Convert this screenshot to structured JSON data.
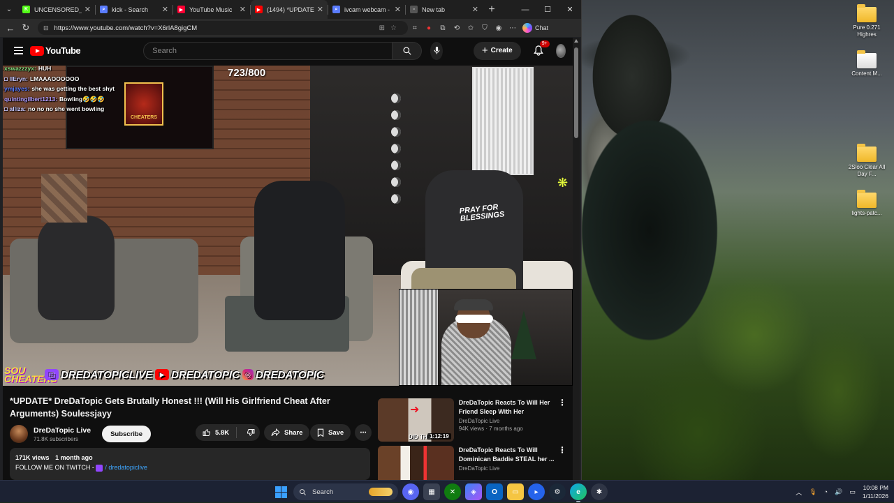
{
  "browser": {
    "tabs": [
      {
        "label": "UNCENSORED_TV S",
        "favicon": "kick-icon",
        "color": "#53fc18",
        "glyph": "K"
      },
      {
        "label": "kick - Search",
        "favicon": "search-icon",
        "color": "#5a7cff",
        "glyph": "⌕"
      },
      {
        "label": "YouTube Music",
        "favicon": "youtube-music-icon",
        "color": "#ff0033",
        "glyph": "▶"
      },
      {
        "label": "(1494) *UPDATE",
        "favicon": "youtube-icon",
        "color": "#ff0000",
        "glyph": "▶",
        "active": true
      },
      {
        "label": "ivcam webcam - Sea",
        "favicon": "search-icon",
        "color": "#5a7cff",
        "glyph": "⌕"
      },
      {
        "label": "New tab",
        "favicon": "new-tab-icon",
        "color": "#555",
        "glyph": "▫"
      }
    ],
    "url": "https://www.youtube.com/watch?v=X6rlA8gigCM",
    "chat_label": "Chat"
  },
  "youtube": {
    "logo_text": "YouTube",
    "search_placeholder": "Search",
    "create_label": "Create",
    "notif_badge": "9+"
  },
  "video": {
    "counter": "723/800",
    "chat": [
      {
        "user": "xswazzzyx:",
        "user_color": "#7fe07f",
        "msg": "HUH"
      },
      {
        "user": "◘ llEryn:",
        "user_color": "#c8c8ff",
        "msg": "LMAAAOOOOOO"
      },
      {
        "user": "ymjayes:",
        "user_color": "#5a7cff",
        "msg": "she was getting the best shyt"
      },
      {
        "user": "quintingilbert1213:",
        "user_color": "#b19cff",
        "msg": "Bowling🤣🤣🤣"
      },
      {
        "user": "◘ alliza:",
        "user_color": "#c8c8ff",
        "msg": "no no no she went bowling"
      }
    ],
    "banner": {
      "show": "SOU CHEATERS",
      "twitch": "DREDATOPICLIVE",
      "youtube": "DREDATOPIC",
      "instagram": "DREDATOPIC"
    },
    "shirt_text": "PRAY FOR BLESSINGS",
    "sign_text": "CHEATERS"
  },
  "watch": {
    "title": "*UPDATE* DreDaTopic Gets Brutally Honest !!! (Will His Girlfriend Cheat After Arguments) Soulessjayy",
    "channel_name": "DreDaTopic Live",
    "subscribers": "71.8K subscribers",
    "subscribe_label": "Subscribe",
    "likes": "5.8K",
    "share_label": "Share",
    "save_label": "Save",
    "views": "171K views",
    "age": "1 month ago",
    "desc_line": "FOLLOW ME ON TWITCH - ",
    "twitch_handle": "/ dredatopiclive"
  },
  "recommended": [
    {
      "title": "DreDaTopic Reacts To Will Her Friend Sleep With Her Boyfrien...",
      "channel": "DreDaTopic Live",
      "meta": "94K views · 7 months ago",
      "duration": "1:12:19",
      "thumb_text": "DID THEY..."
    },
    {
      "title": "DreDaTopic Reacts To Will Dominican Baddie STEAL her ...",
      "channel": "DreDaTopic Live",
      "meta": "",
      "duration": "",
      "thumb_text": ""
    }
  ],
  "desktop_icons": [
    {
      "label": "Pure 0.271 Highres"
    },
    {
      "label": "Content.M..."
    },
    {
      "label": "2Sloo Clear All Day F..."
    },
    {
      "label": "lights-patc..."
    }
  ],
  "taskbar": {
    "search_label": "Search",
    "time": "10:08 PM",
    "date": "1/11/2026"
  },
  "colors": {
    "yt_bg": "#0f0f0f",
    "yt_red": "#ff0000",
    "taskbar": "#1c2233"
  }
}
